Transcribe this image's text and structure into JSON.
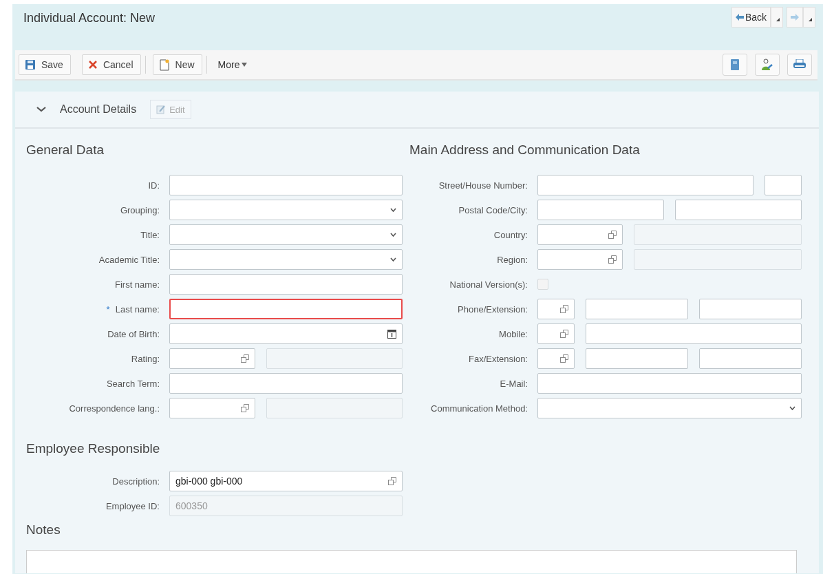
{
  "window": {
    "title": "Individual Account: New"
  },
  "nav": [
    {
      "label": "Back",
      "kind": "back"
    },
    {
      "kind": "forward"
    }
  ],
  "toolbar": {
    "buttons": [
      {
        "label": "Save",
        "kind": "save"
      },
      {
        "label": "Cancel",
        "kind": "cancel"
      },
      {
        "label": "New",
        "kind": "new"
      }
    ],
    "more": "More",
    "icons": [
      {
        "kind": "document"
      },
      {
        "kind": "person"
      },
      {
        "kind": "print"
      }
    ]
  },
  "section": {
    "title": "Account Details",
    "expanded": true,
    "edit": {
      "label": "Edit",
      "disabled": true
    }
  },
  "general": {
    "title": "General Data",
    "fields": [
      {
        "label": "ID:",
        "required": false,
        "inputs": [
          {
            "kind": "text"
          }
        ]
      },
      {
        "label": "Grouping:",
        "required": false,
        "inputs": [
          {
            "kind": "select"
          }
        ]
      },
      {
        "label": "Title:",
        "required": false,
        "inputs": [
          {
            "kind": "select"
          }
        ]
      },
      {
        "label": "Academic Title:",
        "required": false,
        "inputs": [
          {
            "kind": "select"
          }
        ]
      },
      {
        "label": "First name:",
        "required": false,
        "inputs": [
          {
            "kind": "text"
          }
        ]
      },
      {
        "label": "Last name:",
        "required": true,
        "marker": "*",
        "inputs": [
          {
            "kind": "text"
          }
        ]
      },
      {
        "label": "Date of Birth:",
        "required": false,
        "inputs": [
          {
            "kind": "date"
          }
        ]
      },
      {
        "label": "Rating:",
        "required": false,
        "inputs": [
          {
            "kind": "lookup"
          },
          {
            "kind": "display"
          }
        ]
      },
      {
        "label": "Search Term:",
        "required": false,
        "inputs": [
          {
            "kind": "text"
          }
        ]
      },
      {
        "label": "Correspondence lang.:",
        "required": false,
        "inputs": [
          {
            "kind": "lookup"
          },
          {
            "kind": "display"
          }
        ]
      }
    ]
  },
  "address": {
    "title": "Main Address and Communication Data",
    "fields": [
      {
        "label": "Street/House Number:",
        "required": false,
        "inputs": [
          {
            "kind": "text"
          },
          {
            "kind": "short"
          }
        ]
      },
      {
        "label": "Postal Code/City:",
        "required": false,
        "inputs": [
          {
            "kind": "text"
          },
          {
            "kind": "text"
          }
        ]
      },
      {
        "label": "Country:",
        "required": false,
        "inputs": [
          {
            "kind": "lookup"
          },
          {
            "kind": "display"
          }
        ]
      },
      {
        "label": "Region:",
        "required": false,
        "inputs": [
          {
            "kind": "lookup"
          },
          {
            "kind": "display"
          }
        ]
      },
      {
        "label": "National Version(s):",
        "required": false,
        "inputs": [
          {
            "kind": "checkbox",
            "checked": false
          }
        ]
      },
      {
        "label": "Phone/Extension:",
        "required": false,
        "inputs": [
          {
            "kind": "code"
          },
          {
            "kind": "text"
          },
          {
            "kind": "text"
          }
        ]
      },
      {
        "label": "Mobile:",
        "required": false,
        "inputs": [
          {
            "kind": "code"
          },
          {
            "kind": "text"
          }
        ]
      },
      {
        "label": "Fax/Extension:",
        "required": false,
        "inputs": [
          {
            "kind": "code"
          },
          {
            "kind": "text"
          },
          {
            "kind": "text"
          }
        ]
      },
      {
        "label": "E-Mail:",
        "required": false,
        "inputs": [
          {
            "kind": "text"
          }
        ]
      },
      {
        "label": "Communication Method:",
        "required": false,
        "inputs": [
          {
            "kind": "select"
          }
        ]
      }
    ]
  },
  "employee": {
    "title": "Employee Responsible",
    "fields": [
      {
        "label": "Description:",
        "inputs": [
          {
            "kind": "lookup",
            "value": "gbi-000 gbi-000"
          }
        ]
      },
      {
        "label": "Employee ID:",
        "inputs": [
          {
            "kind": "display",
            "value": "600350"
          }
        ]
      }
    ]
  },
  "notes": {
    "title": "Notes"
  }
}
